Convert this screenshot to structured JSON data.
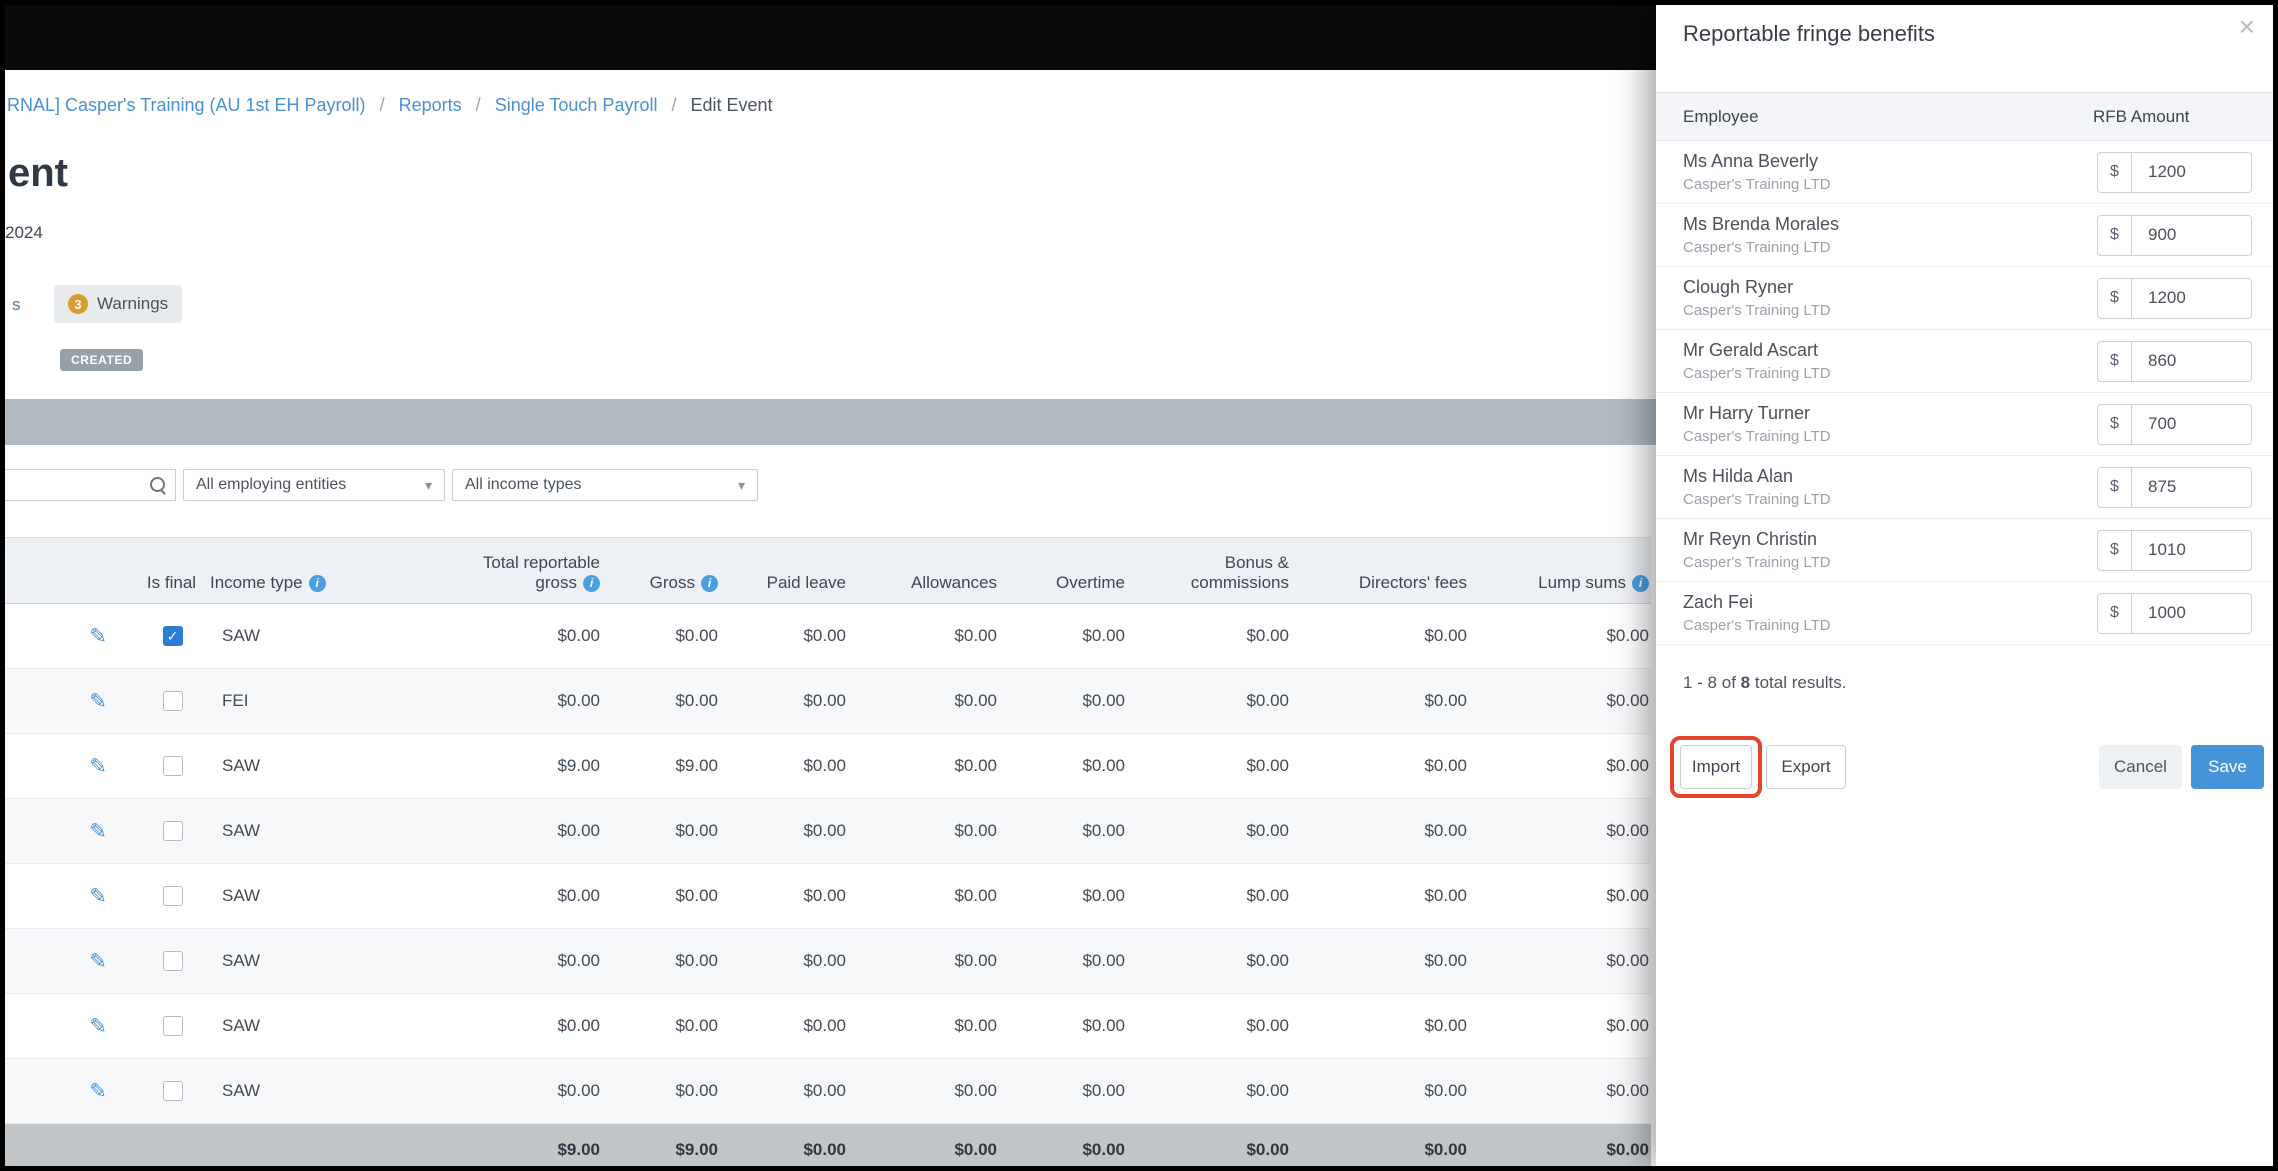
{
  "icons": {
    "caret": "▾",
    "close": "×",
    "pencil": "✎",
    "check": "✓",
    "info": "i"
  },
  "main": {
    "breadcrumb": {
      "items": [
        "RNAL] Casper's Training (AU 1st EH Payroll)",
        "Reports",
        "Single Touch Payroll",
        "Edit Event"
      ],
      "separator": "/"
    },
    "heading_fragment": "ent",
    "date_fragment": "2024",
    "tabs": {
      "partial_tab_fragment": "s",
      "warnings_label": "Warnings",
      "warnings_badge": "3"
    },
    "status_badge": "CREATED",
    "filters": {
      "entities_dropdown": "All employing entities",
      "income_types_dropdown": "All income types"
    },
    "table": {
      "headers": [
        {
          "line1": "Is final"
        },
        {
          "line1": "Income type",
          "info": true
        },
        {
          "line1": "Total reportable",
          "line2": "gross",
          "info": true
        },
        {
          "line1": "Gross",
          "info": true
        },
        {
          "line1": "Paid leave"
        },
        {
          "line1": "Allowances"
        },
        {
          "line1": "Overtime"
        },
        {
          "line1": "Bonus &",
          "line2": "commissions"
        },
        {
          "line1": "Directors' fees"
        },
        {
          "line1": "Lump sums",
          "info": true
        }
      ],
      "rows": [
        {
          "is_final": true,
          "income_type": "SAW",
          "values": [
            "$0.00",
            "$0.00",
            "$0.00",
            "$0.00",
            "$0.00",
            "$0.00",
            "$0.00",
            "$0.00"
          ]
        },
        {
          "is_final": false,
          "income_type": "FEI",
          "values": [
            "$0.00",
            "$0.00",
            "$0.00",
            "$0.00",
            "$0.00",
            "$0.00",
            "$0.00",
            "$0.00"
          ]
        },
        {
          "is_final": false,
          "income_type": "SAW",
          "values": [
            "$9.00",
            "$9.00",
            "$0.00",
            "$0.00",
            "$0.00",
            "$0.00",
            "$0.00",
            "$0.00"
          ]
        },
        {
          "is_final": false,
          "income_type": "SAW",
          "values": [
            "$0.00",
            "$0.00",
            "$0.00",
            "$0.00",
            "$0.00",
            "$0.00",
            "$0.00",
            "$0.00"
          ]
        },
        {
          "is_final": false,
          "income_type": "SAW",
          "values": [
            "$0.00",
            "$0.00",
            "$0.00",
            "$0.00",
            "$0.00",
            "$0.00",
            "$0.00",
            "$0.00"
          ]
        },
        {
          "is_final": false,
          "income_type": "SAW",
          "values": [
            "$0.00",
            "$0.00",
            "$0.00",
            "$0.00",
            "$0.00",
            "$0.00",
            "$0.00",
            "$0.00"
          ]
        },
        {
          "is_final": false,
          "income_type": "SAW",
          "values": [
            "$0.00",
            "$0.00",
            "$0.00",
            "$0.00",
            "$0.00",
            "$0.00",
            "$0.00",
            "$0.00"
          ]
        },
        {
          "is_final": false,
          "income_type": "SAW",
          "values": [
            "$0.00",
            "$0.00",
            "$0.00",
            "$0.00",
            "$0.00",
            "$0.00",
            "$0.00",
            "$0.00"
          ]
        }
      ],
      "totals": [
        "$9.00",
        "$9.00",
        "$0.00",
        "$0.00",
        "$0.00",
        "$0.00",
        "$0.00",
        "$0.00"
      ]
    }
  },
  "panel": {
    "title": "Reportable fringe benefits",
    "columns": {
      "employee": "Employee",
      "amount": "RFB Amount"
    },
    "currency": "$",
    "rows": [
      {
        "name": "Ms Anna Beverly",
        "company": "Casper's Training LTD",
        "amount": "1200"
      },
      {
        "name": "Ms Brenda Morales",
        "company": "Casper's Training LTD",
        "amount": "900"
      },
      {
        "name": "Clough Ryner",
        "company": "Casper's Training LTD",
        "amount": "1200"
      },
      {
        "name": "Mr Gerald Ascart",
        "company": "Casper's Training LTD",
        "amount": "860"
      },
      {
        "name": "Mr Harry Turner",
        "company": "Casper's Training LTD",
        "amount": "700"
      },
      {
        "name": "Ms Hilda Alan",
        "company": "Casper's Training LTD",
        "amount": "875"
      },
      {
        "name": "Mr Reyn Christin",
        "company": "Casper's Training LTD",
        "amount": "1010"
      },
      {
        "name": "Zach Fei",
        "company": "Casper's Training LTD",
        "amount": "1000"
      }
    ],
    "results": {
      "prefix": "1 - 8 of",
      "total": "8",
      "suffix": "total results."
    },
    "buttons": {
      "import": "Import",
      "export": "Export",
      "cancel": "Cancel",
      "save": "Save"
    }
  }
}
